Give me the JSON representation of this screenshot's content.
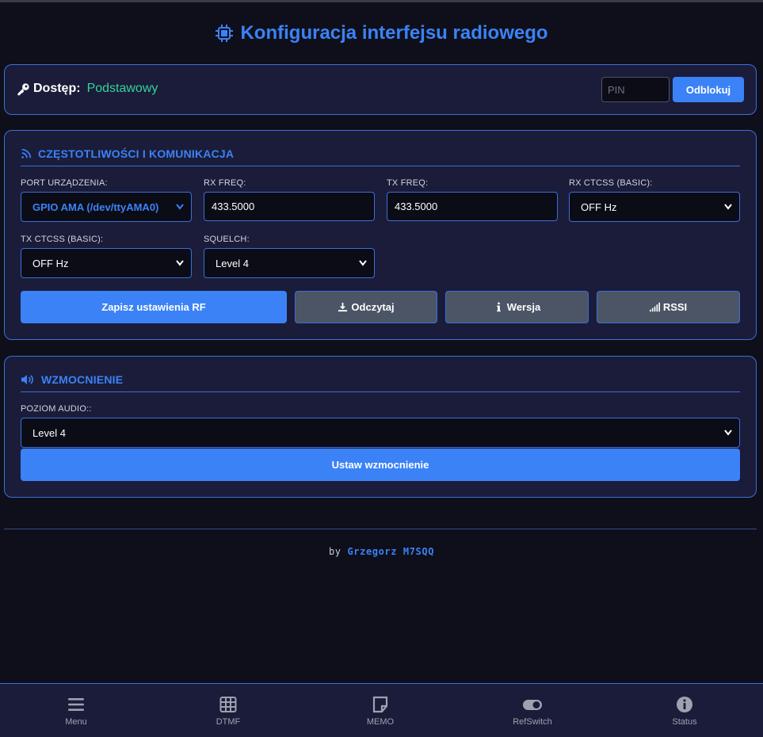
{
  "header": {
    "title": "Konfiguracja interfejsu radiowego",
    "icon": "cpu-chip-icon"
  },
  "access": {
    "label": "Dostęp:",
    "value": "Podstawowy",
    "value_color": "#34d399",
    "pin_placeholder": "PIN",
    "unlock_label": "Odblokuj"
  },
  "rf": {
    "title": "CZĘSTOTLIWOŚCI I KOMUNIKACJA",
    "icon": "rss-feed-icon",
    "port_label": "PORT URZĄDZENIA:",
    "port_value": "GPIO AMA (/dev/ttyAMA0)",
    "rx_freq_label": "RX FREQ:",
    "rx_freq_value": "433.5000",
    "tx_freq_label": "TX FREQ:",
    "tx_freq_value": "433.5000",
    "rx_ctcss_label": "RX CTCSS (BASIC):",
    "rx_ctcss_value": "OFF Hz",
    "tx_ctcss_label": "TX CTCSS (BASIC):",
    "tx_ctcss_value": "OFF Hz",
    "squelch_label": "SQUELCH:",
    "squelch_value": "Level 4",
    "save_label": "Zapisz ustawienia RF",
    "read_label": "Odczytaj",
    "version_label": "Wersja",
    "rssi_label": "RSSI"
  },
  "gain": {
    "title": "WZMOCNIENIE",
    "icon": "speaker-icon",
    "audio_label": "POZIOM AUDIO::",
    "audio_value": "Level 4",
    "set_label": "Ustaw wzmocnienie"
  },
  "footer": {
    "by": "by",
    "author": "Grzegorz M7SQQ"
  },
  "nav": [
    {
      "label": "Menu",
      "icon": "hamburger-icon"
    },
    {
      "label": "DTMF",
      "icon": "keypad-grid-icon"
    },
    {
      "label": "MEMO",
      "icon": "sticky-note-icon"
    },
    {
      "label": "RefSwitch",
      "icon": "toggle-switch-icon"
    },
    {
      "label": "Status",
      "icon": "info-circle-icon"
    }
  ],
  "colors": {
    "accent": "#3b82f6",
    "background": "#0e0f1a",
    "card": "#1a1c3a",
    "border": "#3b6fd9"
  }
}
